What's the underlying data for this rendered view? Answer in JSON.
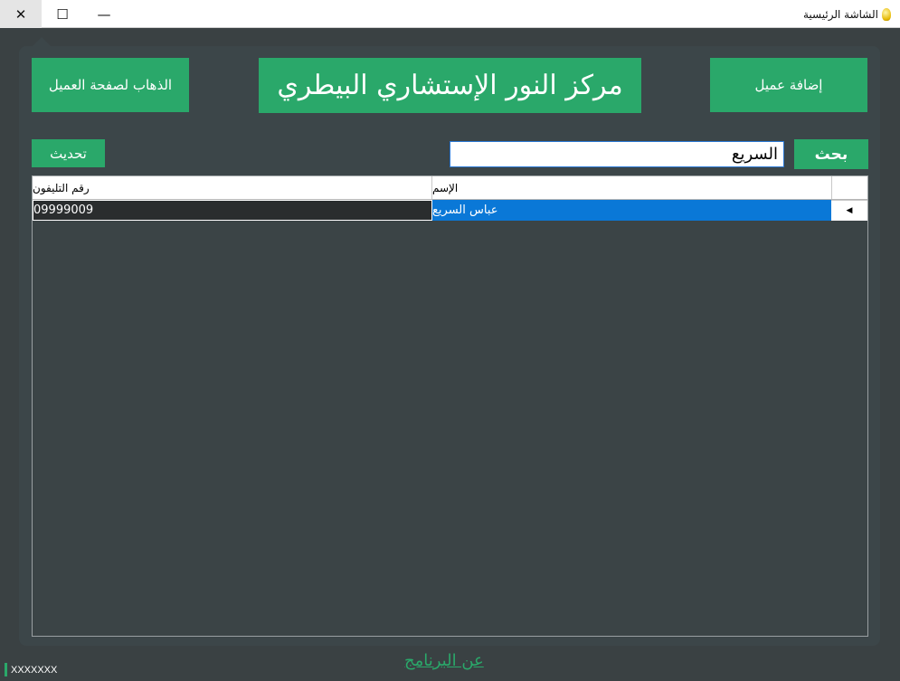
{
  "window": {
    "title": "الشاشة الرئيسية",
    "close_glyph": "✕",
    "maximize_glyph": "☐",
    "minimize_glyph": "—"
  },
  "header": {
    "goto_client_label": "الذهاب لصفحة العميل",
    "banner_title": "مركز النور الإستشاري البيطري",
    "add_client_label": "إضافة عميل"
  },
  "search": {
    "button_label": "بحث",
    "value": "السريع",
    "refresh_label": "تحديث"
  },
  "grid": {
    "columns": {
      "name": "الإسم",
      "phone": "رقم التليفون"
    },
    "rows": [
      {
        "name": "عباس السريع",
        "phone": "09999009",
        "marker": "◀"
      }
    ]
  },
  "footer": {
    "about_link": "عن البرنامج",
    "status_text": "XXXXXXX"
  },
  "colors": {
    "accent": "#2aa86a",
    "background": "#3a4143",
    "selection": "#0a78d7"
  }
}
